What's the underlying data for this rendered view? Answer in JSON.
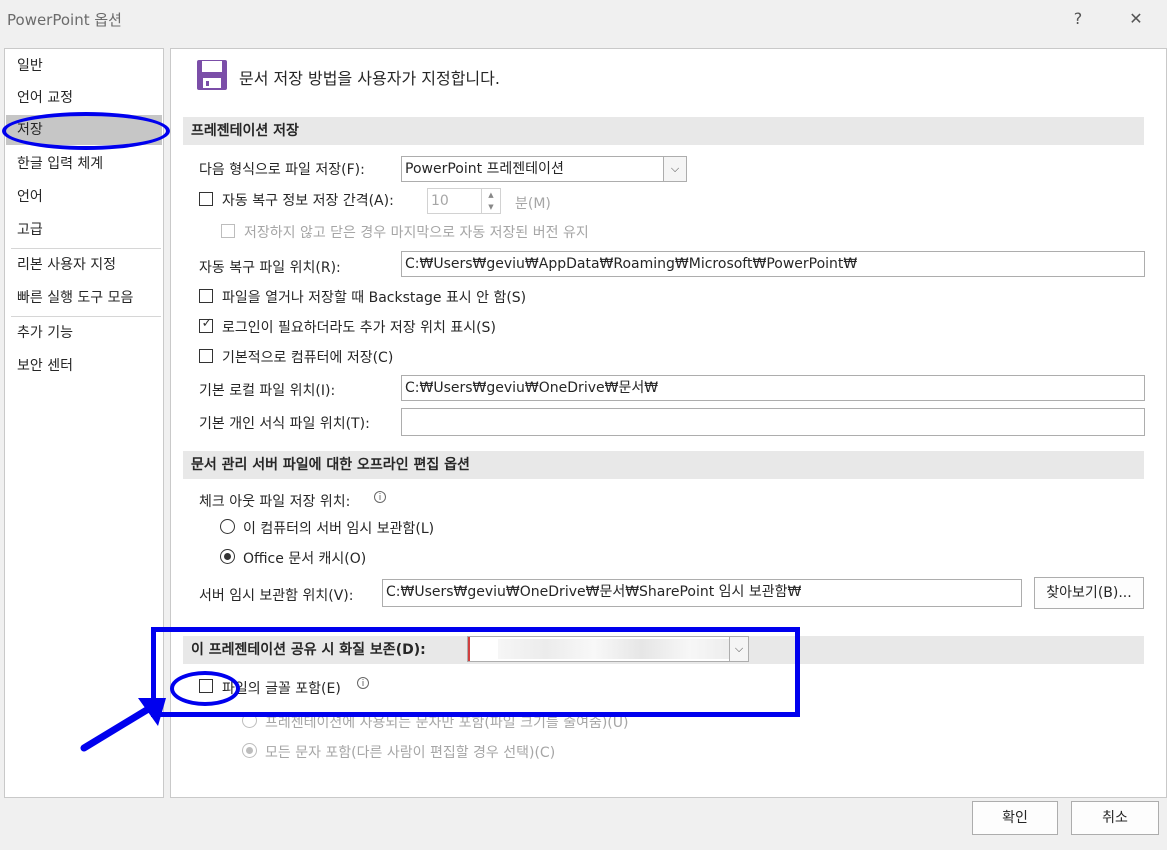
{
  "dialog": {
    "title": "PowerPoint 옵션",
    "help": "?",
    "close": "✕"
  },
  "sidebar": {
    "items": [
      {
        "label": "일반"
      },
      {
        "label": "언어 교정"
      },
      {
        "label": "저장",
        "selected": true
      },
      {
        "label": "한글 입력 체계"
      },
      {
        "label": "언어"
      },
      {
        "label": "고급"
      },
      {
        "label": "리본 사용자 지정"
      },
      {
        "label": "빠른 실행 도구 모음"
      },
      {
        "label": "추가 기능"
      },
      {
        "label": "보안 센터"
      }
    ]
  },
  "header": {
    "icon": "floppy-disk-icon",
    "title": "문서 저장 방법을 사용자가 지정합니다."
  },
  "presentation_save": {
    "section_title": "프레젠테이션 저장",
    "format_label": "다음 형식으로 파일 저장(F):",
    "format_value": "PowerPoint 프레젠테이션",
    "autorecover_label": "자동 복구 정보 저장 간격(A):",
    "autorecover_value": "10",
    "autorecover_unit": "분(M)",
    "keep_last_label": "저장하지 않고 닫은 경우 마지막으로 자동 저장된 버전 유지",
    "autorecover_location_label": "자동 복구 파일 위치(R):",
    "autorecover_location_value": "C:₩Users₩geviu₩AppData₩Roaming₩Microsoft₩PowerPoint₩",
    "backstage_label": "파일을 열거나 저장할 때 Backstage 표시 안 함(S)",
    "show_locations_label": "로그인이 필요하더라도 추가 저장 위치 표시(S)",
    "save_to_computer_label": "기본적으로 컴퓨터에 저장(C)",
    "local_location_label": "기본 로컬 파일 위치(I):",
    "local_location_value": "C:₩Users₩geviu₩OneDrive₩문서₩",
    "template_location_label": "기본 개인 서식 파일 위치(T):",
    "template_location_value": ""
  },
  "offline_editing": {
    "section_title": "문서 관리 서버 파일에 대한 오프라인 편집 옵션",
    "checkout_label": "체크 아웃 파일 저장 위치:",
    "option_server_drafts": "이 컴퓨터의 서버 임시 보관함(L)",
    "option_office_cache": "Office 문서 캐시(O)",
    "drafts_location_label": "서버 임시 보관함 위치(V):",
    "drafts_location_value": "C:₩Users₩geviu₩OneDrive₩문서₩SharePoint 임시 보관함₩",
    "browse_label": "찾아보기(B)..."
  },
  "fidelity": {
    "section_title": "이 프레젠테이션 공유 시 화질 보존(D):",
    "embed_fonts_label": "파일의 글꼴 포함(E)",
    "option_used_chars": "프레젠테이션에 사용되는 문자만 포함(파일 크기를 줄여줌)(U)",
    "option_all_chars": "모든 문자 포함(다른 사람이 편집할 경우 선택)(C)"
  },
  "footer": {
    "ok_label": "확인",
    "cancel_label": "취소"
  },
  "colors": {
    "annotation": "#0000ee",
    "selected_nav": "#c6c6c6",
    "section_bg": "#e8e8e8",
    "icon_purple": "#7b4ea8"
  }
}
